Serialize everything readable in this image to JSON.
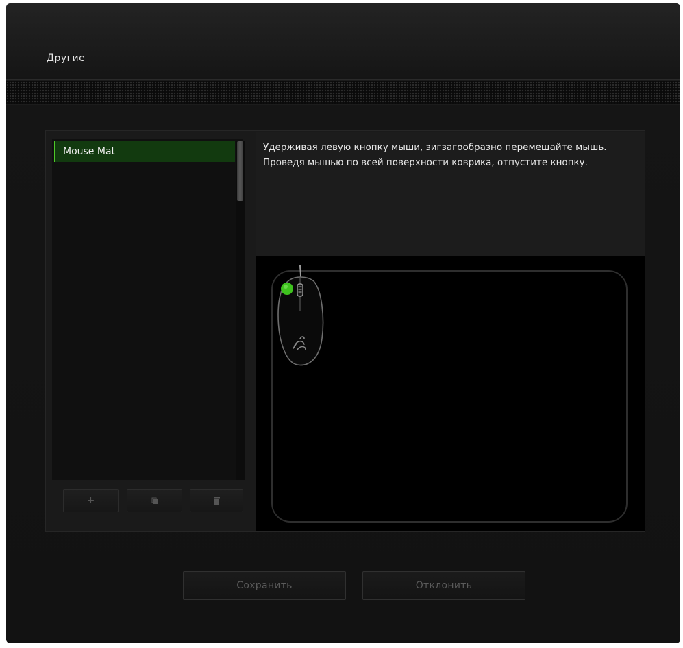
{
  "header": {
    "title": "Другие"
  },
  "list": {
    "items": [
      {
        "label": "Mouse Mat",
        "selected": true
      }
    ],
    "buttons": {
      "add_icon": "plus-icon",
      "copy_icon": "copy-icon",
      "delete_icon": "trash-icon"
    }
  },
  "instructions": {
    "text": "Удерживая левую кнопку мыши, зигзагообразно перемещайте мышь. Проведя мышью по всей поверхности коврика, отпустите кнопку."
  },
  "footer": {
    "save_label": "Сохранить",
    "cancel_label": "Отклонить"
  },
  "colors": {
    "accent": "#4fc928",
    "selected_bg": "#123a0f",
    "background": "#0d0d0d"
  }
}
